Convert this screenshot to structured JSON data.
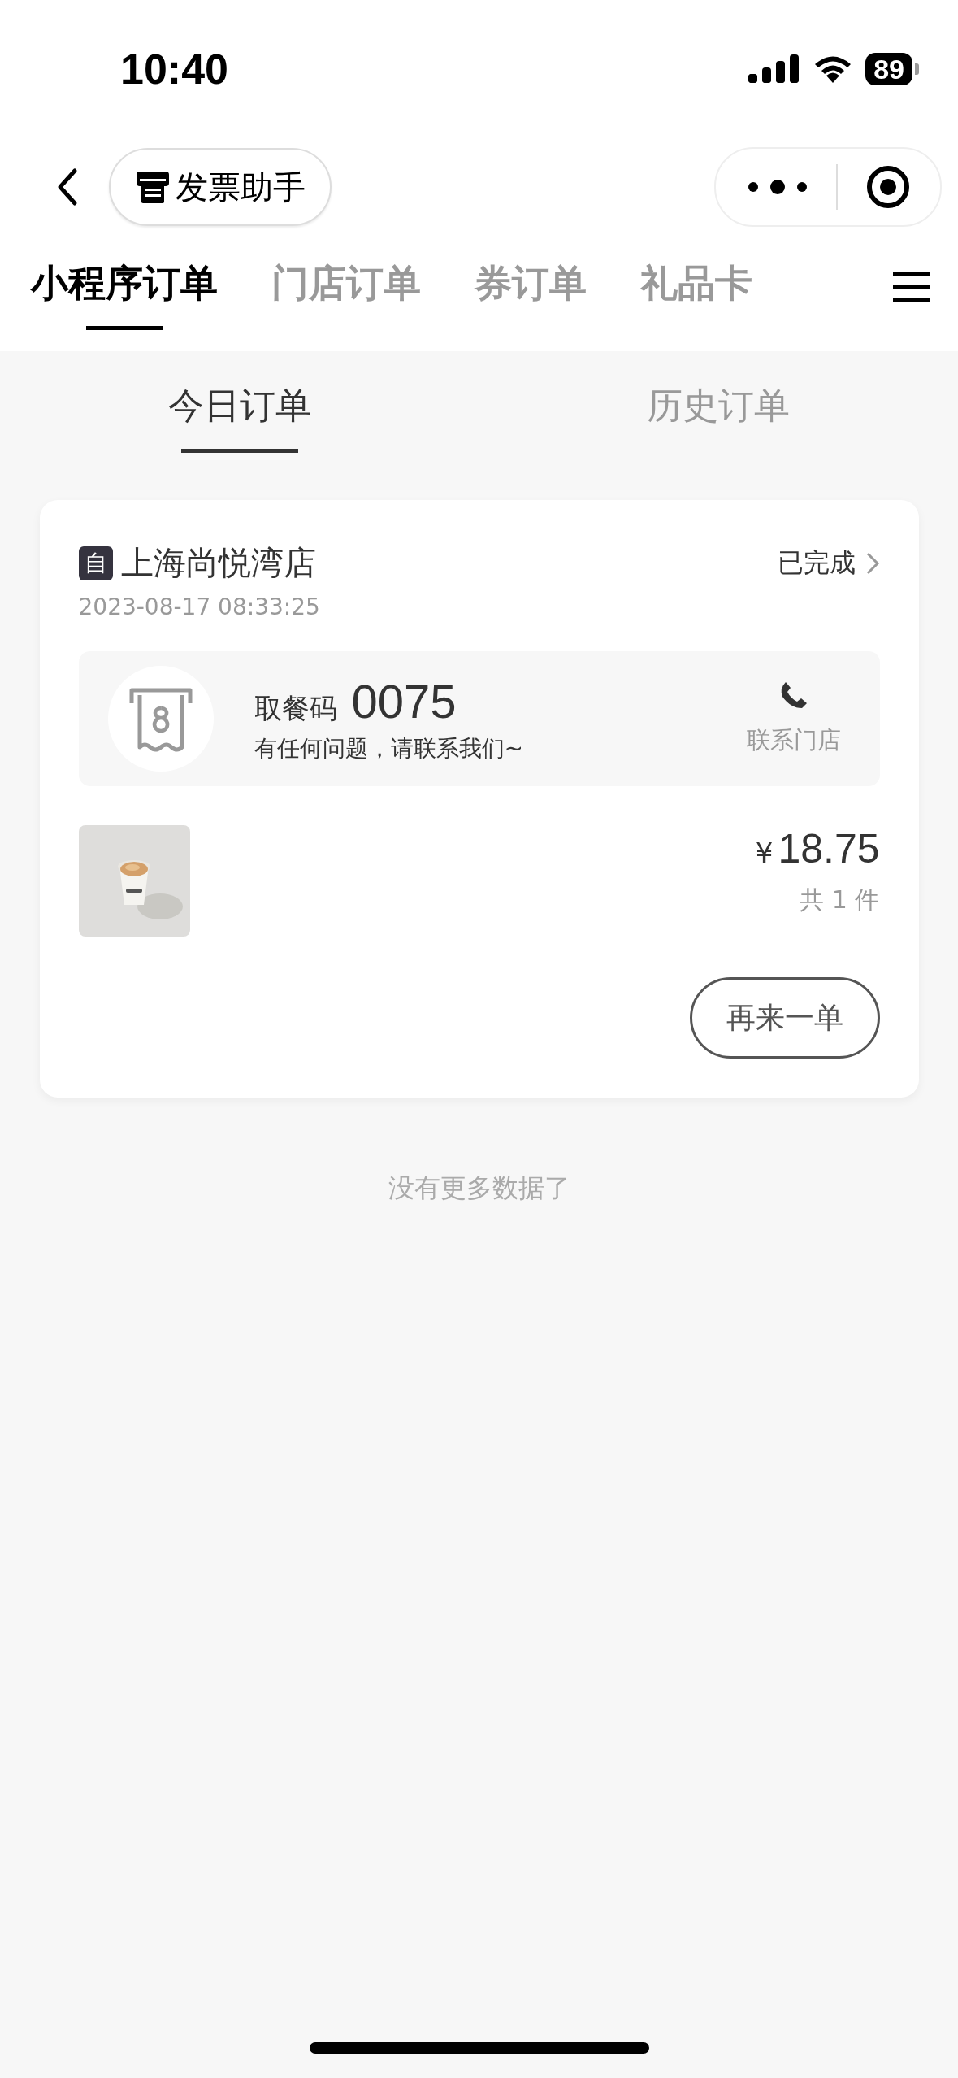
{
  "status_bar": {
    "time": "10:40",
    "battery": "89"
  },
  "nav": {
    "title": "发票助手"
  },
  "tabs": [
    {
      "label": "小程序订单",
      "selected": true
    },
    {
      "label": "门店订单",
      "selected": false
    },
    {
      "label": "券订单",
      "selected": false
    },
    {
      "label": "礼品卡",
      "selected": false
    }
  ],
  "sub_tabs": [
    {
      "label": "今日订单",
      "selected": true
    },
    {
      "label": "历史订单",
      "selected": false
    }
  ],
  "orders": [
    {
      "badge": "自",
      "store": "上海尚悦湾店",
      "status": "已完成",
      "time": "2023-08-17 08:33:25",
      "pickup_label": "取餐码",
      "pickup_code": "0075",
      "help": "有任何问题，请联系我们~",
      "contact": "联系门店",
      "price_symbol": "¥",
      "price": "18.75",
      "count": "共 1 件",
      "reorder": "再来一单"
    }
  ],
  "footer": "没有更多数据了"
}
